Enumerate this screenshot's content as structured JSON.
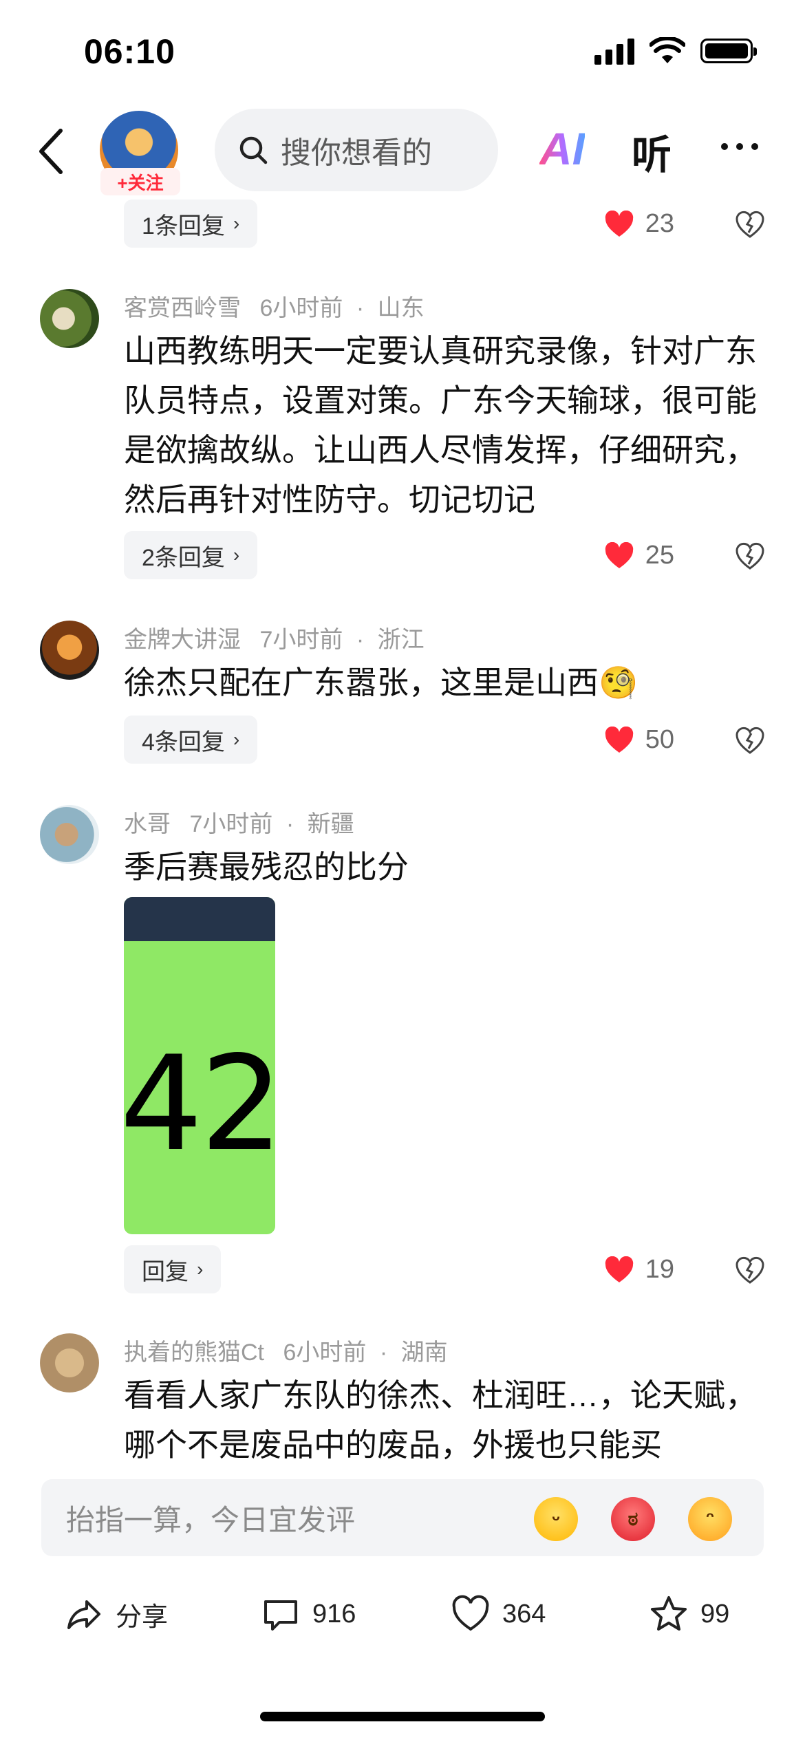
{
  "status_bar": {
    "time": "06:10"
  },
  "header": {
    "follow_label": "+关注",
    "search_placeholder": "搜你想看的",
    "ai_label": "AI",
    "listen_label": "听"
  },
  "comments": [
    {
      "reply_label": "1条回复",
      "likes": "23"
    },
    {
      "user": "客赏西岭雪",
      "time": "6小时前",
      "location": "山东",
      "text": "山西教练明天一定要认真研究录像，针对广东队员特点，设置对策。广东今天输球，很可能是欲擒故纵。让山西人尽情发挥，仔细研究，然后再针对性防守。切记切记",
      "reply_label": "2条回复",
      "likes": "25"
    },
    {
      "user": "金牌大讲湿",
      "time": "7小时前",
      "location": "浙江",
      "text": "徐杰只配在广东嚣张，这里是山西🧐",
      "reply_label": "4条回复",
      "likes": "50"
    },
    {
      "user": "水哥",
      "time": "7小时前",
      "location": "新疆",
      "text": "季后赛最残忍的比分",
      "image_text": "42",
      "reply_label": "回复",
      "likes": "19"
    },
    {
      "user": "执着的熊猫Ct",
      "time": "6小时前",
      "location": "湖南",
      "text": "看看人家广东队的徐杰、杜润旺…，论天赋，哪个不是废品中的废品，外援也只能买"
    }
  ],
  "input": {
    "placeholder": "抬指一算，今日宜发评"
  },
  "bottom_bar": {
    "share_label": "分享",
    "comment_count": "916",
    "like_count": "364",
    "favorite_count": "99"
  },
  "colors": {
    "like_red": "#ff2a3a",
    "meta_gray": "#9a9a9a",
    "pill_bg": "#f3f4f6"
  }
}
